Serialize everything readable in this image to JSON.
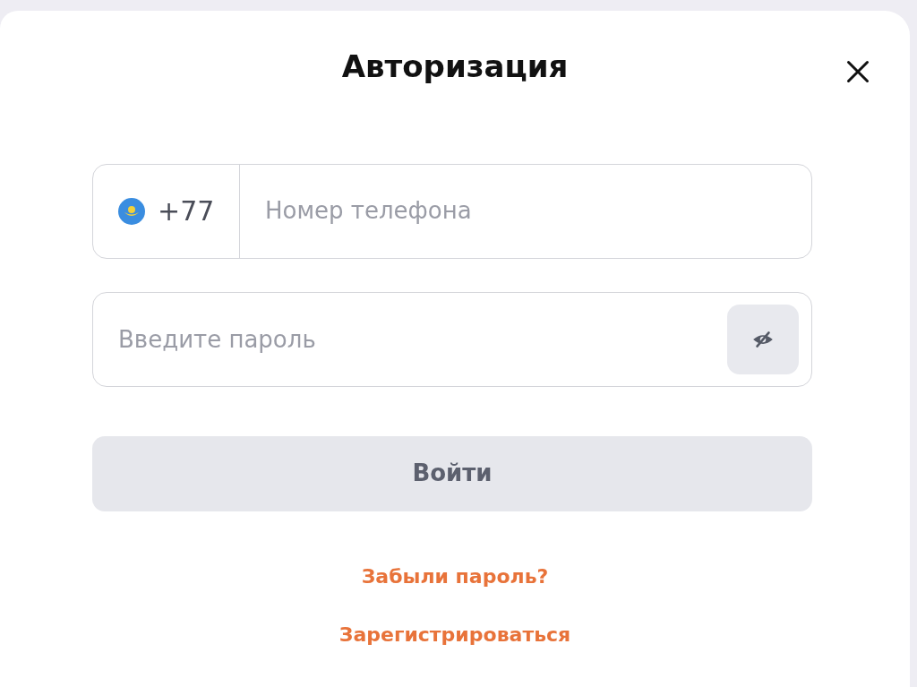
{
  "dialog": {
    "title": "Авторизация"
  },
  "phone": {
    "country_code": "+77",
    "placeholder": "Номер телефона"
  },
  "password": {
    "placeholder": "Введите пароль",
    "visible": false
  },
  "submit": {
    "label": "Войти",
    "disabled": true
  },
  "links": [
    "Забыли пароль?",
    "Зарегистрироваться"
  ]
}
